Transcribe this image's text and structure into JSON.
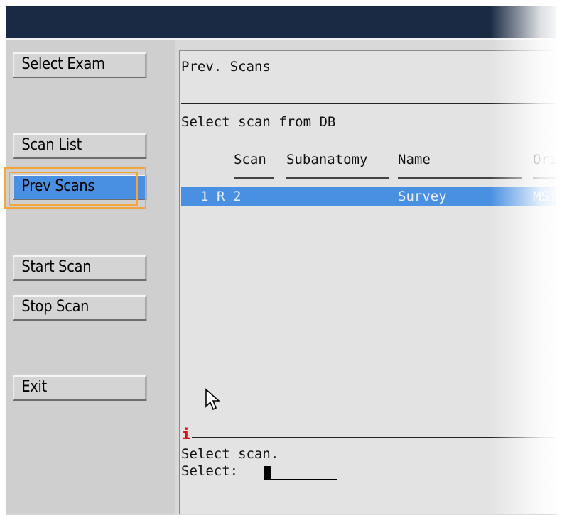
{
  "sidebar": {
    "buttons": [
      {
        "label": "Select Exam"
      },
      {
        "label": "Scan List"
      },
      {
        "label": "Prev Scans"
      },
      {
        "label": "Start Scan"
      },
      {
        "label": "Stop Scan"
      },
      {
        "label": "Exit"
      }
    ],
    "active_index": 2
  },
  "panel": {
    "title": "Prev. Scans",
    "subtitle": "Select scan from DB",
    "columns": [
      "Scan",
      "Subanatomy",
      "Name",
      "Ori"
    ],
    "rows": [
      {
        "index": "1",
        "flag": "R",
        "scan": "2",
        "subanatomy": "",
        "name": "Survey",
        "ori": "MST"
      }
    ]
  },
  "console": {
    "info_icon": "i",
    "message": "Select scan.",
    "prompt": "Select:"
  },
  "colors": {
    "titlebar": "#1b2a44",
    "selection": "#4a90e2",
    "highlight": "#f4a63a",
    "info": "#dd1111"
  },
  "icons": {
    "info": "info-icon",
    "pointer": "mouse-pointer-icon"
  }
}
